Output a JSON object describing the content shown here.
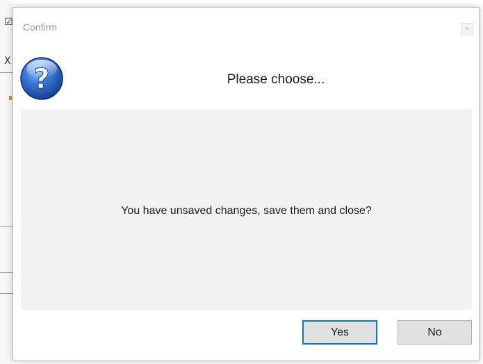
{
  "dialog": {
    "title": "Confirm",
    "close_glyph": "×",
    "icon": "question-icon",
    "heading": "Please choose...",
    "message": "You have unsaved changes, save them and close?",
    "buttons": {
      "yes_label": "Yes",
      "no_label": "No"
    },
    "default_button": "yes"
  },
  "background": {
    "glyphs": [
      "☑",
      "X"
    ]
  },
  "colors": {
    "accent_focus": "#0078d7",
    "panel_bg": "#f2f2f2",
    "button_bg": "#e1e1e1",
    "icon_blue": "#2a5fb0"
  }
}
